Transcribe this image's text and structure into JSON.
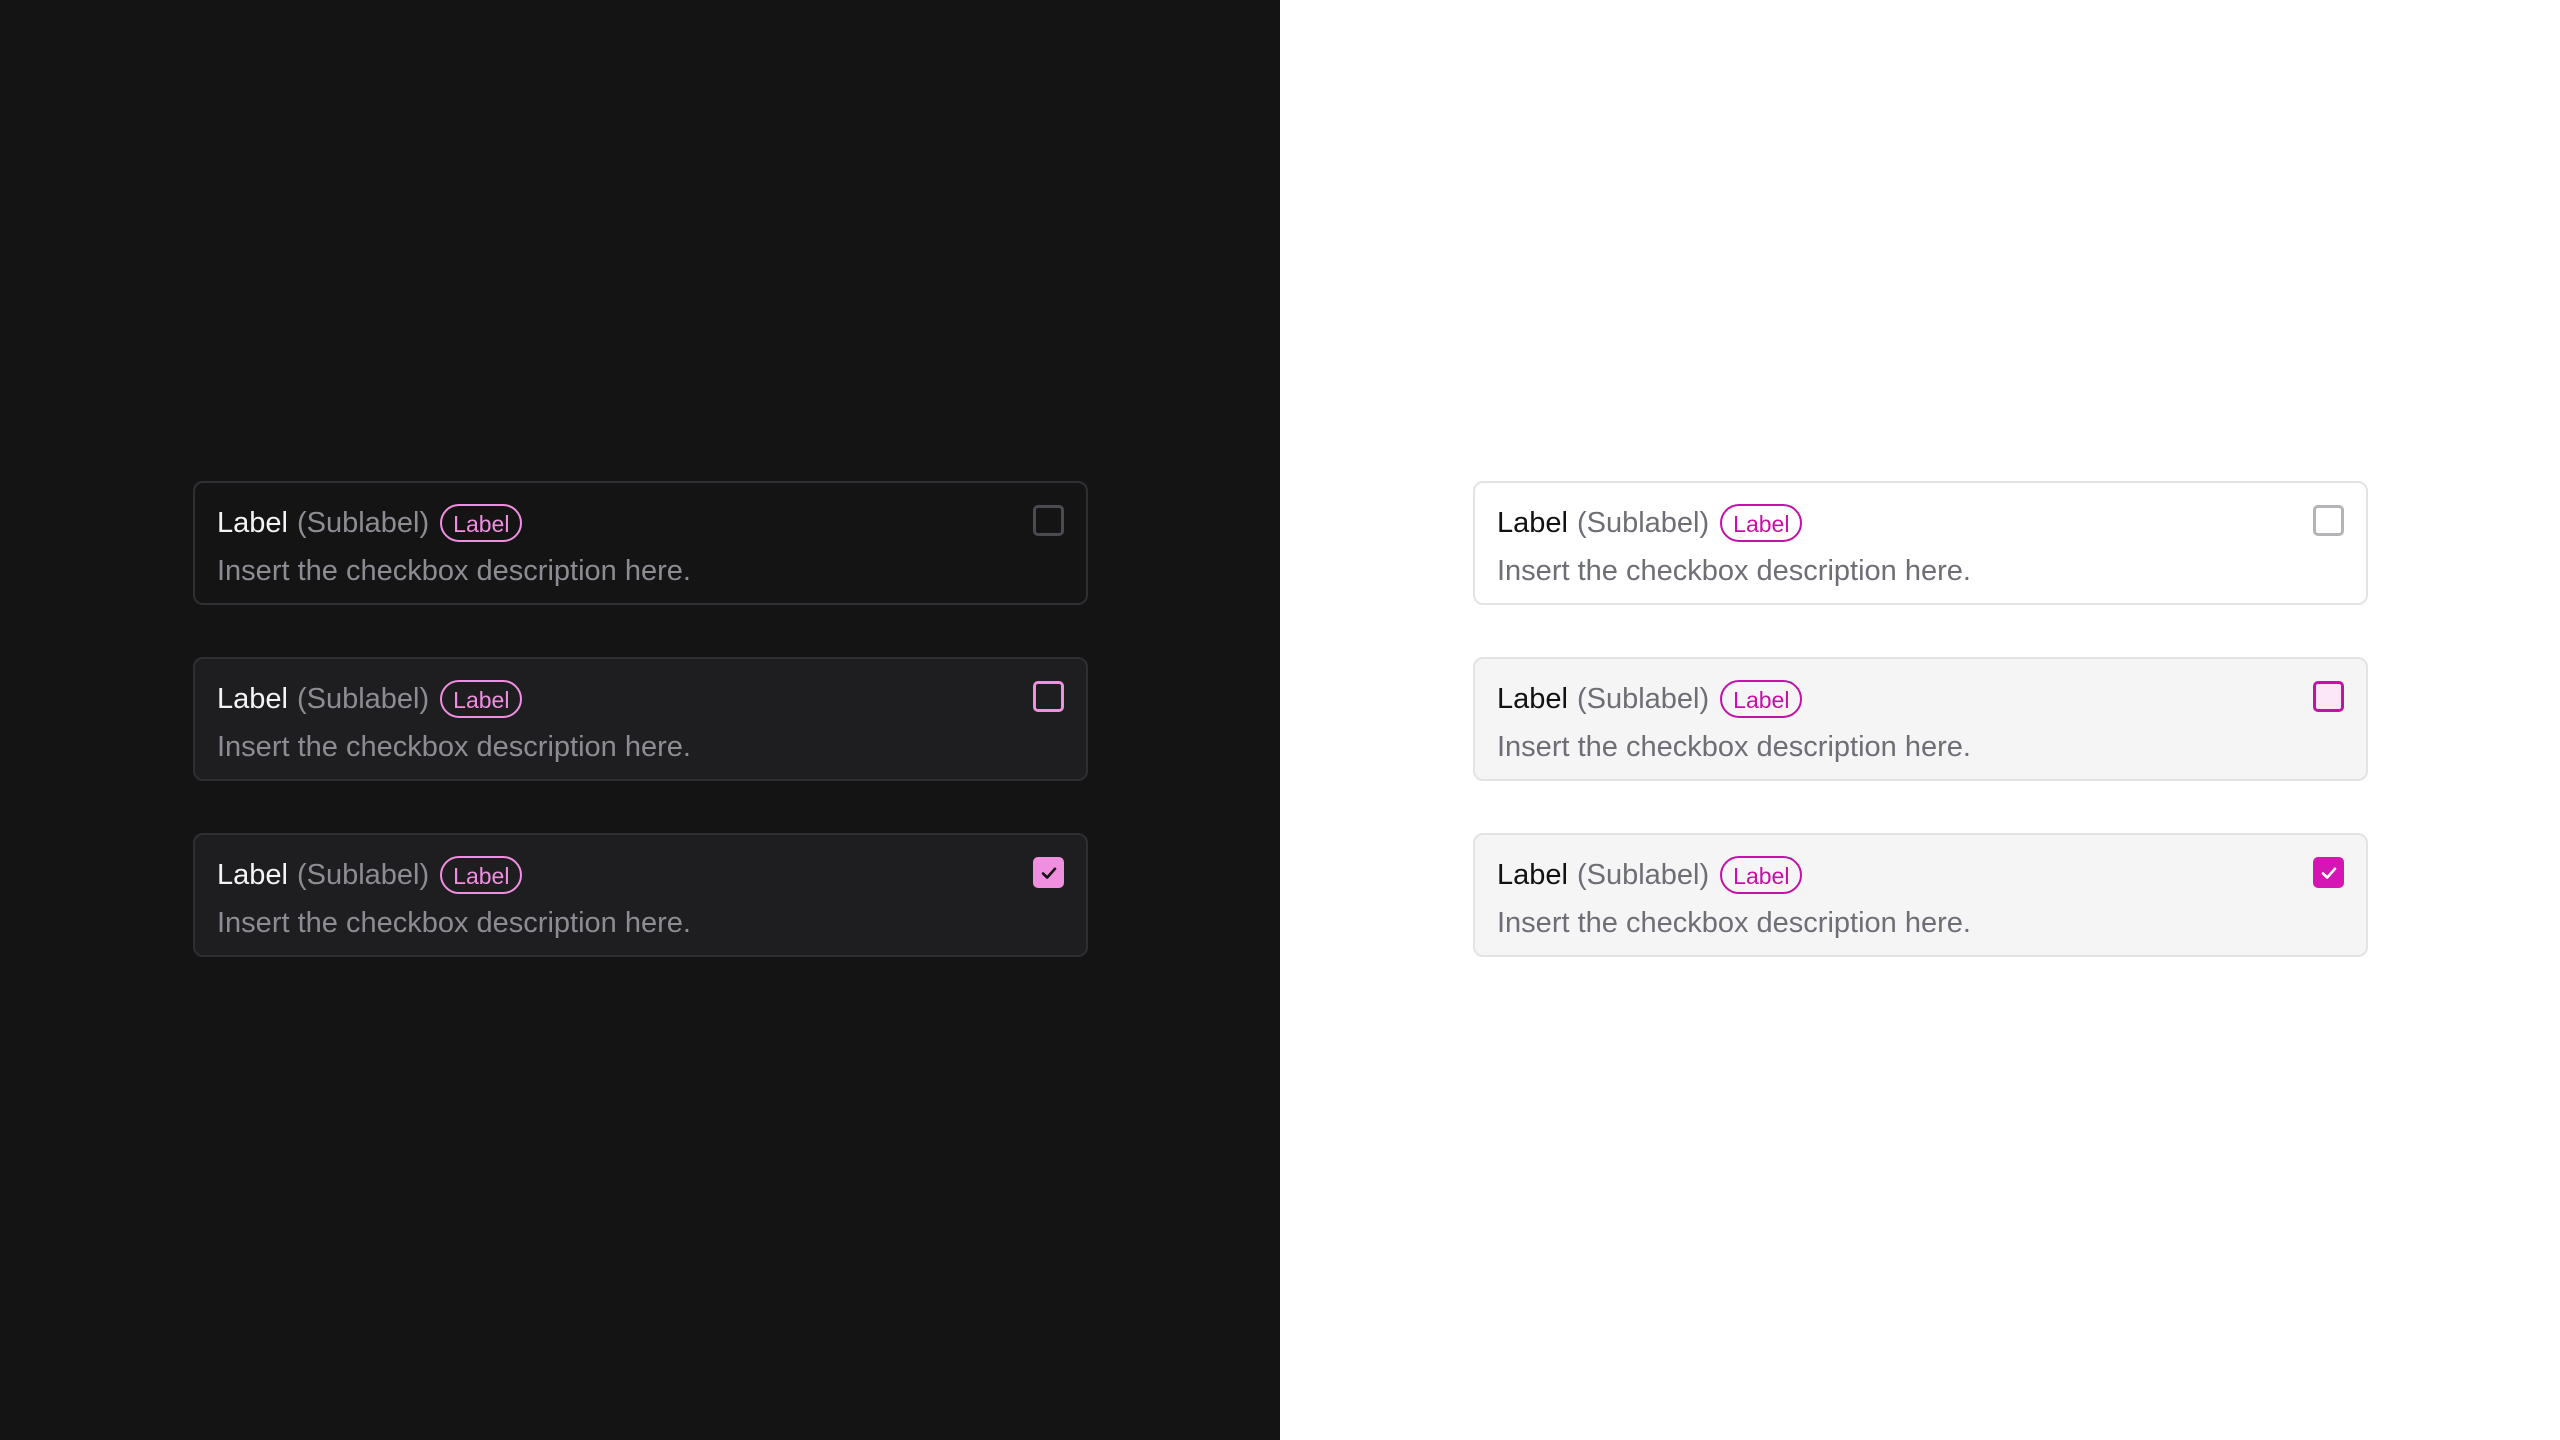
{
  "dark_panel": {
    "cards": [
      {
        "label": "Label",
        "sublabel": "(Sublabel)",
        "badge": "Label",
        "description": "Insert the checkbox description here.",
        "state": "default",
        "checked": false
      },
      {
        "label": "Label",
        "sublabel": "(Sublabel)",
        "badge": "Label",
        "description": "Insert the checkbox description here.",
        "state": "hover",
        "checked": false
      },
      {
        "label": "Label",
        "sublabel": "(Sublabel)",
        "badge": "Label",
        "description": "Insert the checkbox description here.",
        "state": "checked",
        "checked": true
      }
    ]
  },
  "light_panel": {
    "cards": [
      {
        "label": "Label",
        "sublabel": "(Sublabel)",
        "badge": "Label",
        "description": "Insert the checkbox description here.",
        "state": "default",
        "checked": false
      },
      {
        "label": "Label",
        "sublabel": "(Sublabel)",
        "badge": "Label",
        "description": "Insert the checkbox description here.",
        "state": "hover",
        "checked": false
      },
      {
        "label": "Label",
        "sublabel": "(Sublabel)",
        "badge": "Label",
        "description": "Insert the checkbox description here.",
        "state": "checked",
        "checked": true
      }
    ]
  },
  "colors": {
    "dark_bg": "#141415",
    "dark_accent": "#f08ee0",
    "light_bg": "#ffffff",
    "light_accent": "#d616b4"
  },
  "icons": {
    "check": "checkmark-icon"
  }
}
